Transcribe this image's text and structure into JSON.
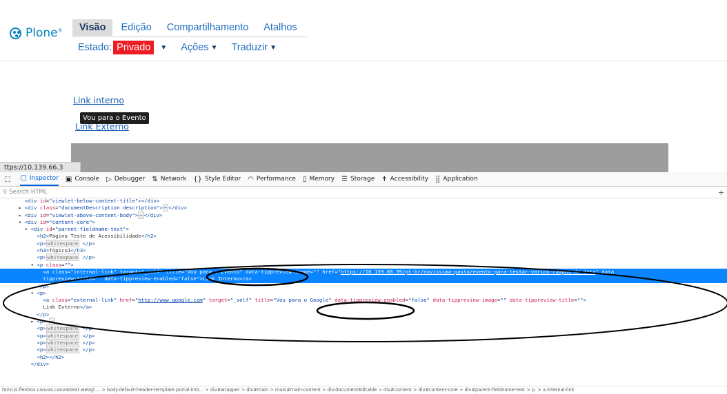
{
  "plone": {
    "logo_text": "Plone",
    "tabs": [
      {
        "label": "Visão",
        "active": true
      },
      {
        "label": "Edição",
        "active": false
      },
      {
        "label": "Compartilhamento",
        "active": false
      },
      {
        "label": "Atalhos",
        "active": false
      }
    ],
    "state_label": "Estado:",
    "state_value": "Privado",
    "actions_label": "Ações",
    "translate_label": "Traduzir"
  },
  "page": {
    "link_internal": "Link interno",
    "link_external": "Link Externo",
    "tooltip": "Vou para o Evento",
    "status_url": "ttps://10.139.66.3"
  },
  "devtools": {
    "tabs": [
      {
        "icon": "inspector-icon",
        "glyph": "▢",
        "label": "Inspector",
        "active": true
      },
      {
        "icon": "console-icon",
        "glyph": "▣",
        "label": "Console"
      },
      {
        "icon": "debugger-icon",
        "glyph": "▷",
        "label": "Debugger"
      },
      {
        "icon": "network-icon",
        "glyph": "⇅",
        "label": "Network"
      },
      {
        "icon": "style-editor-icon",
        "glyph": "{}",
        "label": "Style Editor"
      },
      {
        "icon": "performance-icon",
        "glyph": "◠",
        "label": "Performance"
      },
      {
        "icon": "memory-icon",
        "glyph": "▯",
        "label": "Memory"
      },
      {
        "icon": "storage-icon",
        "glyph": "☰",
        "label": "Storage"
      },
      {
        "icon": "accessibility-icon",
        "glyph": "✝",
        "label": "Accessibility"
      },
      {
        "icon": "application-icon",
        "glyph": "⣿",
        "label": "Application"
      }
    ],
    "search_placeholder": "Search HTML",
    "breadcrumb": "html.js.flexbox.canvas.canvastext.webgl.... > body.default-header-template.portal-inst... > div#wrapper > div#main > main#main-content > div.documentEditable > div#content > div#content-core > div#parent-fieldname-text > p. > a.internal-link"
  },
  "colors": {
    "plone_blue": "#0083be",
    "privado_red": "#ed1c24",
    "selection_blue": "#0a84ff"
  }
}
